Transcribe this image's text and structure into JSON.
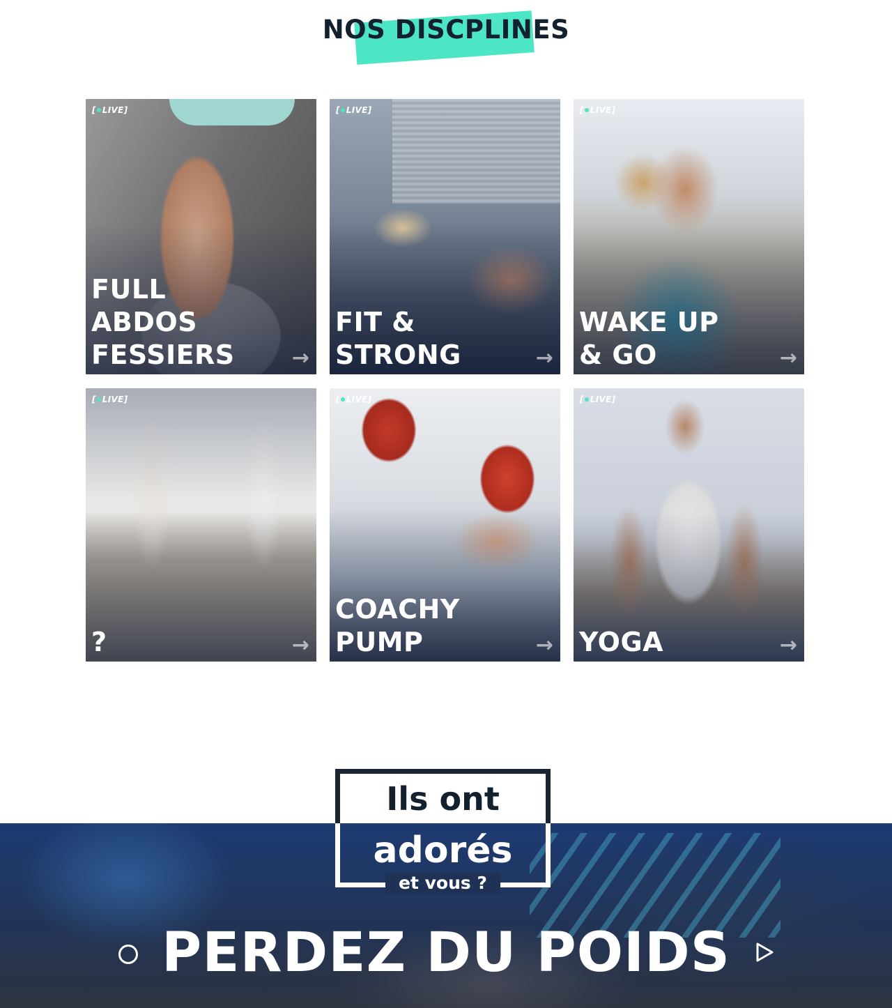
{
  "section": {
    "title": "NOS DISCPLINES"
  },
  "live_label": "LIVE",
  "disciplines": [
    {
      "title": "FULL\nABDOS\nFESSIERS",
      "badge": "[•LIVE]"
    },
    {
      "title": "FIT &\nSTRONG",
      "badge": "[•LIVE]"
    },
    {
      "title": "WAKE UP\n& GO",
      "badge": "[•LIVE]"
    },
    {
      "title": "?",
      "badge": "[•LIVE]"
    },
    {
      "title": "COACHY\nPUMP",
      "badge": "[•LIVE]"
    },
    {
      "title": "YOGA",
      "badge": "[•LIVE]"
    }
  ],
  "arrow_glyph": "→",
  "testimonials": {
    "badge_line1": "Ils ont",
    "badge_line2": "adorés",
    "badge_line3": "et vous ?",
    "headline": "PERDEZ DU POIDS"
  },
  "colors": {
    "accent": "#4de6c5",
    "dark": "#13202e",
    "banner": "#1d3b72"
  },
  "icons": {
    "prev": "circle-icon",
    "next": "play-triangle-icon",
    "card_arrow": "arrow-right-icon"
  }
}
